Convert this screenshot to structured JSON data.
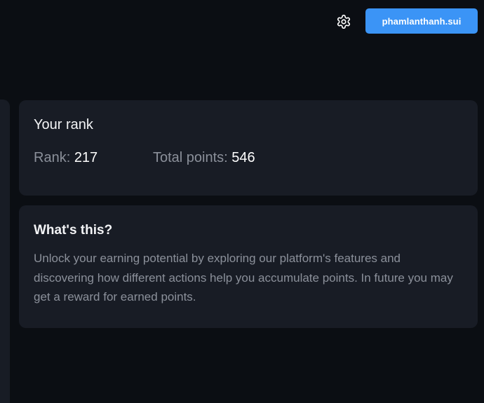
{
  "header": {
    "settings_icon": "gear-icon",
    "wallet_label": "phamlanthanh.sui",
    "wallet_color": "#3b94f6"
  },
  "rank_card": {
    "title": "Your rank",
    "rank_label": "Rank:",
    "rank_value": "217",
    "points_label": "Total points:",
    "points_value": "546"
  },
  "info_card": {
    "title": "What's this?",
    "description": "Unlock your earning potential by exploring our platform's features and discovering how different actions help you accumulate points. In future you may get a reward for earned points."
  },
  "colors": {
    "background": "#0b0e13",
    "card": "#181c25",
    "muted_text": "#8b909a",
    "text": "#ffffff"
  }
}
